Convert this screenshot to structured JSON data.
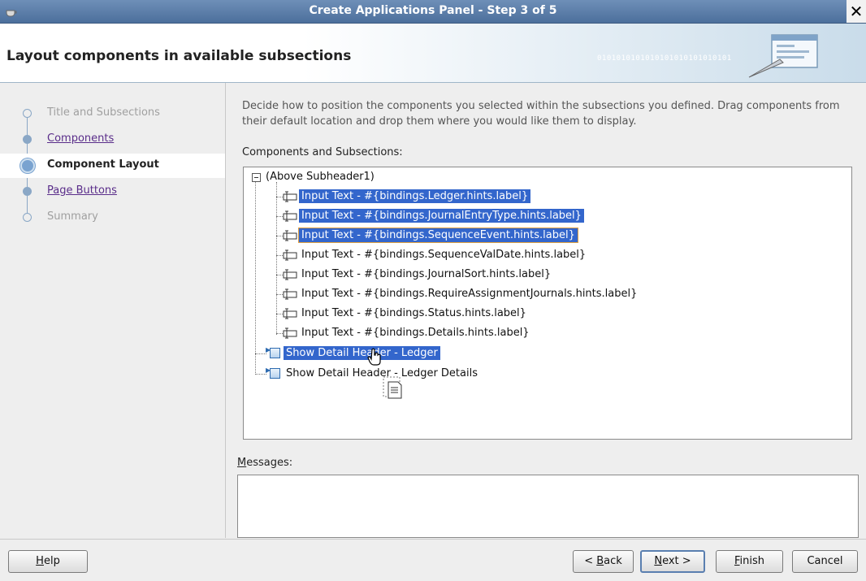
{
  "window": {
    "title": "Create Applications Panel - Step 3 of 5",
    "close_glyph": "✕"
  },
  "header": {
    "heading": "Layout components in available subsections",
    "binary_decoration": "0101010101010101010101010101"
  },
  "steps": [
    {
      "label": "Title and Subsections",
      "state": "disabled"
    },
    {
      "label": "Components",
      "state": "link"
    },
    {
      "label": "Component Layout",
      "state": "current"
    },
    {
      "label": "Page Buttons",
      "state": "link"
    },
    {
      "label": "Summary",
      "state": "disabled"
    }
  ],
  "main": {
    "description": "Decide how to position the components you selected within the subsections you defined. Drag components from their default location and drop them where you would like them to display.",
    "components_label": "Components and Subsections:",
    "tree": {
      "root": "(Above Subheader1)",
      "children": [
        "Input Text - #{bindings.Ledger.hints.label}",
        "Input Text - #{bindings.JournalEntryType.hints.label}",
        "Input Text - #{bindings.SequenceEvent.hints.label}",
        "Input Text - #{bindings.SequenceValDate.hints.label}",
        "Input Text - #{bindings.JournalSort.hints.label}",
        "Input Text - #{bindings.RequireAssignmentJournals.hints.label}",
        "Input Text - #{bindings.Status.hints.label}",
        "Input Text - #{bindings.Details.hints.label}"
      ],
      "siblings": [
        "Show Detail Header - Ledger",
        "Show Detail Header - Ledger Details"
      ]
    },
    "messages_label_first": "M",
    "messages_label_rest": "essages:"
  },
  "buttons": {
    "help": {
      "u": "H",
      "rest": "elp"
    },
    "back": {
      "pre": "< ",
      "u": "B",
      "rest": "ack"
    },
    "next": {
      "u": "N",
      "rest": "ext >"
    },
    "finish": {
      "u": "F",
      "rest": "inish"
    },
    "cancel": "Cancel"
  },
  "colors": {
    "selection": "#3366cc",
    "titlebar": "#4c6f9c",
    "link": "#5a2d8a"
  }
}
